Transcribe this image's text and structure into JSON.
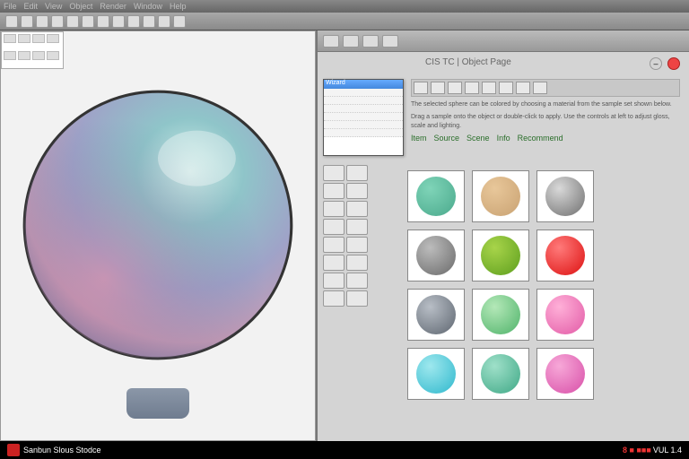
{
  "app": {
    "title": "Sanbun Slous Stodce",
    "version_label": "VUL 1.4"
  },
  "menu": {
    "items": [
      "File",
      "Edit",
      "View",
      "Object",
      "Render",
      "Window",
      "Help"
    ]
  },
  "right": {
    "header": "CIS TC | Object Page",
    "mini_window_title": "Wizard",
    "description1": "The selected sphere can be colored by choosing a material from the sample set shown below.",
    "description2": "Drag a sample onto the object or double-click to apply. Use the controls at left to adjust gloss, scale and lighting.",
    "tabs": {
      "a": "Item",
      "b": "Source",
      "c": "Scene",
      "d": "Info",
      "e": "Recommend"
    }
  },
  "swatches": [
    {
      "name": "teal-matte",
      "c1": "#7fd4b8",
      "c2": "#4aa98c"
    },
    {
      "name": "tan-matte",
      "c1": "#e8c79a",
      "c2": "#c9a272"
    },
    {
      "name": "grey-split",
      "c1": "#d9d9d9",
      "c2": "#6f6f6f"
    },
    {
      "name": "grey-gloss",
      "c1": "#bcbcbc",
      "c2": "#6a6a6a"
    },
    {
      "name": "green-gloss",
      "c1": "#a8d44a",
      "c2": "#5e9f1e"
    },
    {
      "name": "red-gloss",
      "c1": "#ff7a7a",
      "c2": "#d11"
    },
    {
      "name": "steel",
      "c1": "#b8bec6",
      "c2": "#5e6670"
    },
    {
      "name": "mint-gloss",
      "c1": "#b4e8b8",
      "c2": "#4fb36a"
    },
    {
      "name": "pink-gloss",
      "c1": "#ffb0d8",
      "c2": "#e25aa6"
    },
    {
      "name": "cyan-glass",
      "c1": "#9ee8ee",
      "c2": "#2fb8cd"
    },
    {
      "name": "jade",
      "c1": "#9fe0c9",
      "c2": "#3fa886"
    },
    {
      "name": "magenta",
      "c1": "#f7a8d8",
      "c2": "#d84fa8"
    }
  ]
}
